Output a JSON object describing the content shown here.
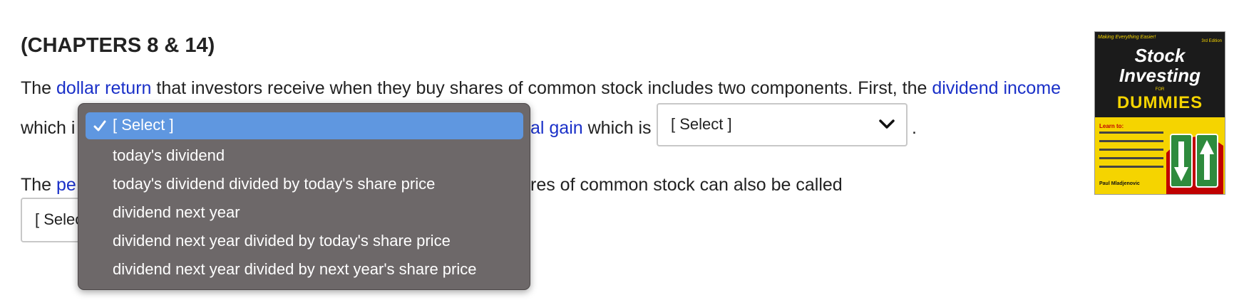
{
  "heading": "(CHAPTERS 8 & 14)",
  "line1": {
    "p1": "The ",
    "h1": "dollar return",
    "p2": " that investors receive when they buy shares of common stock includes two components. First, the ",
    "h2": "dividend income"
  },
  "line2": {
    "p1": "which i",
    "h1": "al gain",
    "p2": " which is ",
    "end": "."
  },
  "line3": {
    "p1": "The ",
    "h1": "pe",
    "p2": "res of common stock can also be called"
  },
  "select_right": {
    "value": "[ Select ]"
  },
  "select_bottom": {
    "value": "[ Selec"
  },
  "dropdown": {
    "options": [
      "[ Select ]",
      "today's dividend",
      "today's dividend divided by today's share price",
      "dividend next year",
      "dividend next year divided by today's share price",
      "dividend next year divided by next year's share price"
    ]
  },
  "book": {
    "tagline": "Making Everything Easier!",
    "edition": "3rd Edition",
    "title1": "Stock",
    "title2": "Investing",
    "for": "FOR",
    "brand": "DUMMIES",
    "learn": "Learn to:",
    "author": "Paul Mladjenovic",
    "colors": {
      "cover": "#f5d400",
      "dark": "#1b1b1b",
      "accent": "#c00000",
      "sign": "#2e8b3d"
    }
  },
  "colors": {
    "highlight": "#1a30c8",
    "dropdown_bg": "#6d6869",
    "selected_bg": "#5f97e0"
  }
}
